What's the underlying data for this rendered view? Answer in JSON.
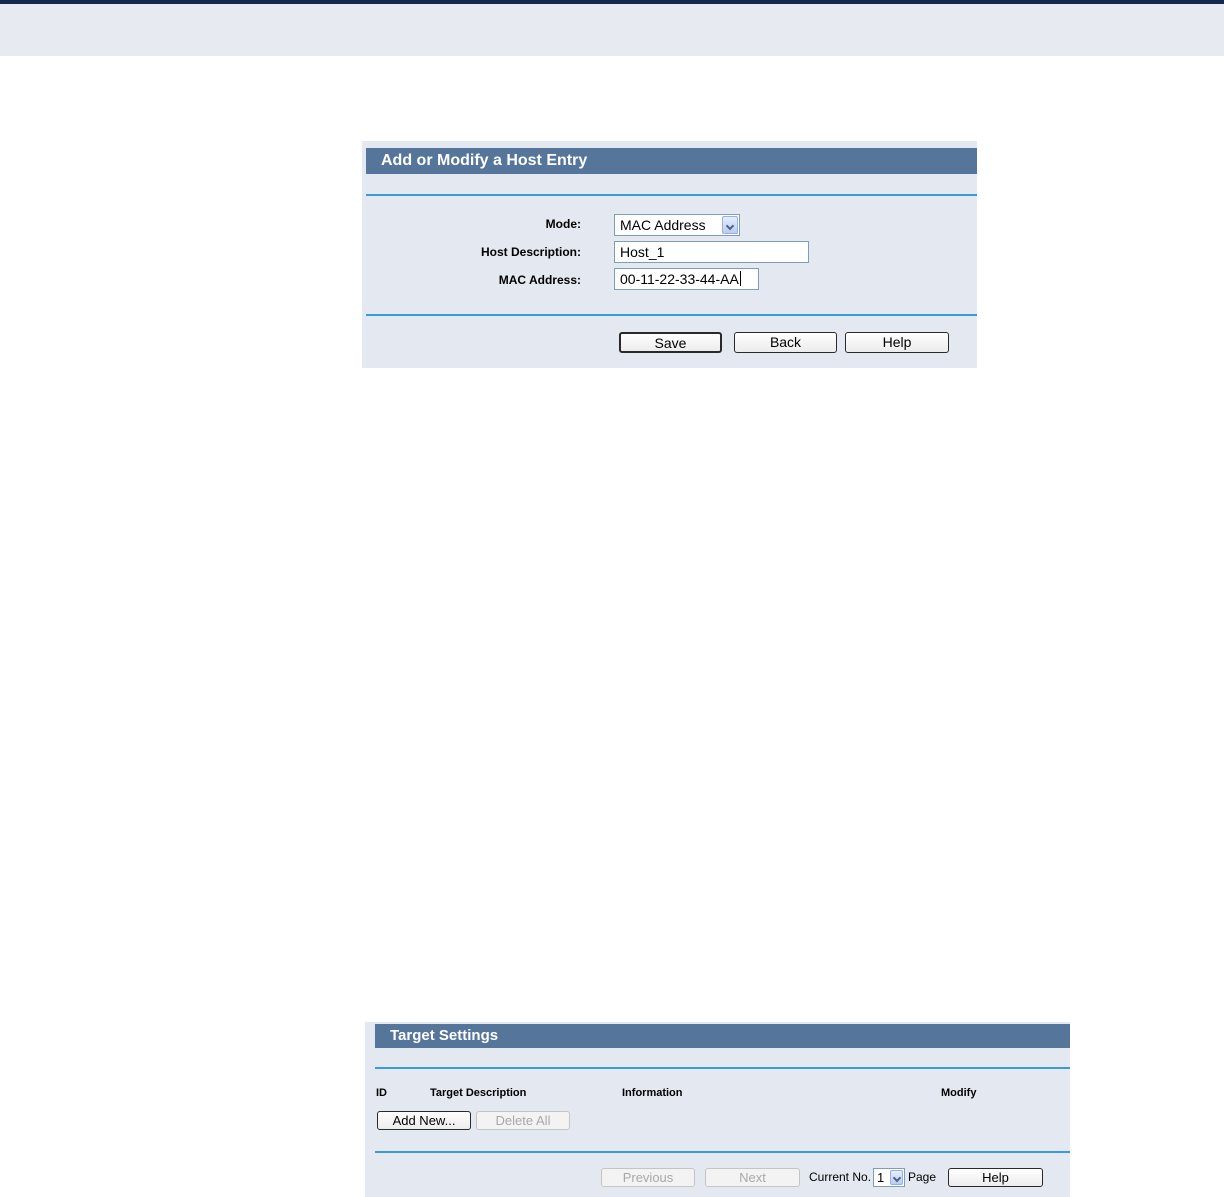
{
  "host_entry": {
    "title": "Add or Modify a Host Entry",
    "mode_label": "Mode:",
    "mode_value": "MAC Address",
    "host_description_label": "Host Description:",
    "host_description_value": "Host_1",
    "mac_address_label": "MAC Address:",
    "mac_address_value": "00-11-22-33-44-AA",
    "buttons": {
      "save": "Save",
      "back": "Back",
      "help": "Help"
    }
  },
  "target_settings": {
    "title": "Target Settings",
    "columns": [
      "ID",
      "Target Description",
      "Information",
      "Modify"
    ],
    "buttons": {
      "add_new": "Add New...",
      "delete_all": "Delete All"
    },
    "pagination": {
      "previous": "Previous",
      "next": "Next",
      "current_no_label": "Current No.",
      "current_page": "1",
      "page_label": "Page",
      "help": "Help"
    }
  },
  "colors": {
    "header_bar": "#56759a",
    "panel_bg": "#e4e8f0",
    "divider": "#3a9bd6",
    "top_line": "#13284f"
  }
}
